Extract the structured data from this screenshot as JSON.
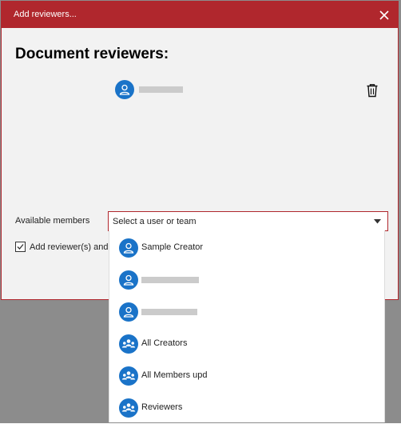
{
  "dialog": {
    "title": "Add reviewers...",
    "heading": "Document reviewers:"
  },
  "available_members": {
    "label": "Available members",
    "placeholder": "Select a user or team"
  },
  "checkbox": {
    "label": "Add reviewer(s) and c",
    "checked": true
  },
  "dropdown_options": [
    {
      "label": "Sample Creator",
      "icon": "user-icon"
    },
    {
      "label": "",
      "icon": "user-icon"
    },
    {
      "label": "",
      "icon": "user-icon"
    },
    {
      "label": "All Creators",
      "icon": "team-icon"
    },
    {
      "label": "All Members upd",
      "icon": "team-icon"
    },
    {
      "label": "Reviewers",
      "icon": "team-icon"
    }
  ],
  "colors": {
    "accent": "#b0272d",
    "avatar": "#1a73c8",
    "dialog_bg": "#f2f2f2",
    "backdrop": "#8c8c8c"
  }
}
